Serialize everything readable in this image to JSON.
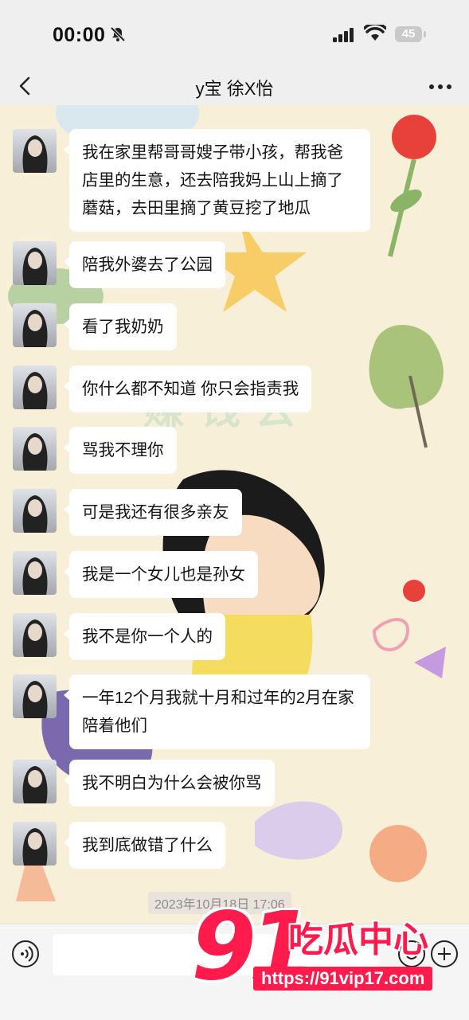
{
  "status_bar": {
    "time": "00:00",
    "battery": "45",
    "icons": [
      "bell-slash-icon",
      "signal-icon",
      "wifi-icon",
      "battery-icon"
    ]
  },
  "nav": {
    "title": "y宝 徐X怡",
    "back_icon": "chevron-left-icon",
    "more_icon": "more-dots-icon"
  },
  "messages": [
    {
      "text": "我在家里帮哥哥嫂子带小孩，帮我爸店里的生意，还去陪我妈上山上摘了蘑菇，去田里摘了黄豆挖了地瓜"
    },
    {
      "text": "陪我外婆去了公园"
    },
    {
      "text": "看了我奶奶"
    },
    {
      "text": "你什么都不知道 你只会指责我"
    },
    {
      "text": "骂我不理你"
    },
    {
      "text": "可是我还有很多亲友"
    },
    {
      "text": "我是一个女儿也是孙女"
    },
    {
      "text": "我不是你一个人的"
    },
    {
      "text": "一年12个月我就十月和过年的2月在家陪着他们"
    },
    {
      "text": "我不明白为什么会被你骂"
    },
    {
      "text": "我到底做错了什么"
    }
  ],
  "timestamp": "2023年10月18日 17:06",
  "input_bar": {
    "placeholder": "",
    "icons": [
      "voice-icon",
      "emoji-icon",
      "plus-icon"
    ]
  },
  "watermark": {
    "number": "91",
    "brand": "吃瓜中心",
    "url": "https://91vip17.com"
  },
  "colors": {
    "bubble": "#ffffff",
    "chat_background": "#f8efd9",
    "watermark": "#ff1c4c"
  }
}
